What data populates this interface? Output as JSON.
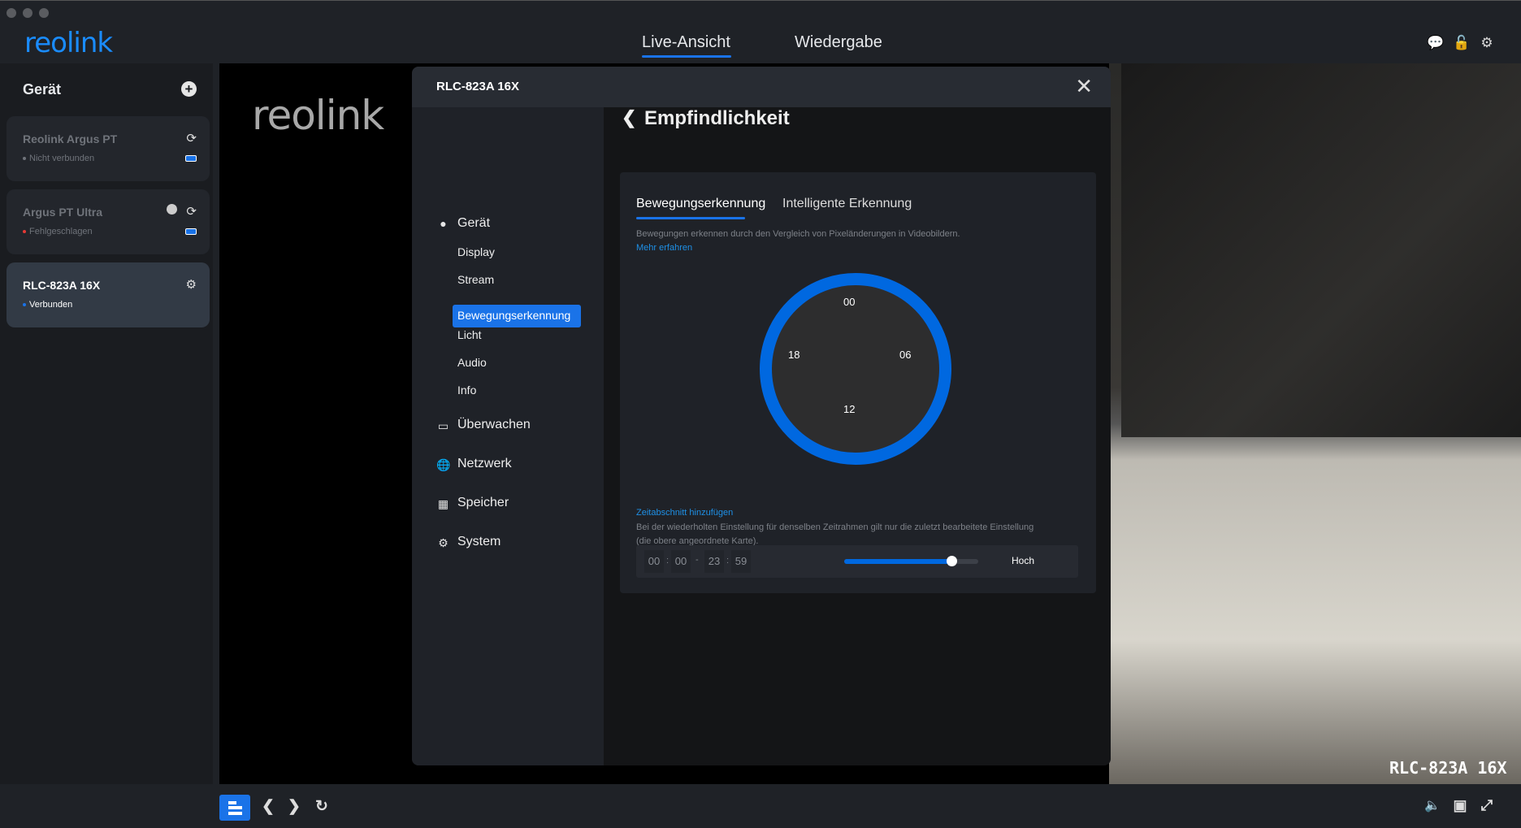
{
  "app": {
    "logo": "reolink",
    "tabs": [
      {
        "label": "Live-Ansicht",
        "active": true
      },
      {
        "label": "Wiedergabe",
        "active": false
      }
    ],
    "top_icons": [
      "chat-icon",
      "unlock-icon",
      "gear-icon"
    ]
  },
  "sidebar": {
    "title": "Gerät",
    "devices": [
      {
        "name": "Reolink Argus PT",
        "status": "Nicht verbunden",
        "status_color": "#6f737a"
      },
      {
        "name": "Argus PT Ultra",
        "status": "Fehlgeschlagen",
        "status_color": "#e53935"
      },
      {
        "name": "RLC-823A 16X",
        "status": "Verbunden",
        "status_color": "#1a73e8"
      }
    ]
  },
  "video": {
    "logo": "reolink",
    "osd": "RLC-823A 16X"
  },
  "modal": {
    "title": "RLC-823A 16X",
    "nav": {
      "device": "Gerät",
      "sub": [
        "Display",
        "Stream",
        "Bewegungserkennung",
        "Licht",
        "Audio",
        "Info"
      ],
      "monitor": "Überwachen",
      "network": "Netzwerk",
      "storage": "Speicher",
      "system": "System"
    },
    "page_title": "Empfindlichkeit",
    "tabs": [
      "Bewegungserkennung",
      "Intelligente Erkennung"
    ],
    "description": "Bewegungen erkennen durch den Vergleich von Pixeländerungen in Videobildern.",
    "learn_more": "Mehr erfahren",
    "clock_labels": {
      "top": "00",
      "right": "06",
      "bottom": "12",
      "left": "18"
    },
    "add_period": "Zeitabschnitt hinzufügen",
    "note": "Bei der wiederholten Einstellung für denselben Zeitrahmen gilt nur die zuletzt bearbeitete Einstellung",
    "note2": "(die obere angeordnete Karte).",
    "schedule": {
      "start_h": "00",
      "start_m": "00",
      "sep": "-",
      "end_h": "23",
      "end_m": "59",
      "colon": ":",
      "sensitivity_fraction": 0.8,
      "level_label": "Hoch"
    }
  },
  "colors": {
    "accent": "#1a73e8"
  }
}
